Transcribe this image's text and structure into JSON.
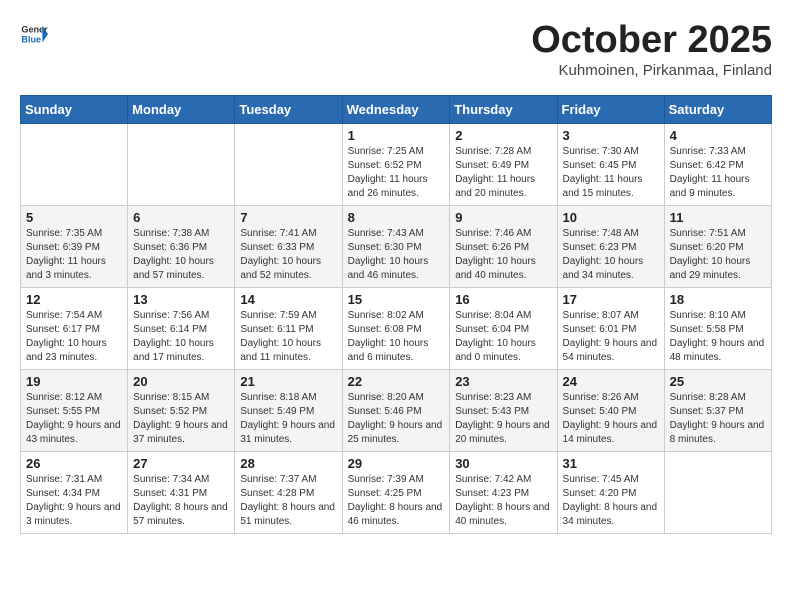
{
  "header": {
    "logo_general": "General",
    "logo_blue": "Blue",
    "month": "October 2025",
    "location": "Kuhmoinen, Pirkanmaa, Finland"
  },
  "days_of_week": [
    "Sunday",
    "Monday",
    "Tuesday",
    "Wednesday",
    "Thursday",
    "Friday",
    "Saturday"
  ],
  "weeks": [
    [
      {
        "day": "",
        "content": ""
      },
      {
        "day": "",
        "content": ""
      },
      {
        "day": "",
        "content": ""
      },
      {
        "day": "1",
        "content": "Sunrise: 7:25 AM\nSunset: 6:52 PM\nDaylight: 11 hours and 26 minutes."
      },
      {
        "day": "2",
        "content": "Sunrise: 7:28 AM\nSunset: 6:49 PM\nDaylight: 11 hours and 20 minutes."
      },
      {
        "day": "3",
        "content": "Sunrise: 7:30 AM\nSunset: 6:45 PM\nDaylight: 11 hours and 15 minutes."
      },
      {
        "day": "4",
        "content": "Sunrise: 7:33 AM\nSunset: 6:42 PM\nDaylight: 11 hours and 9 minutes."
      }
    ],
    [
      {
        "day": "5",
        "content": "Sunrise: 7:35 AM\nSunset: 6:39 PM\nDaylight: 11 hours and 3 minutes."
      },
      {
        "day": "6",
        "content": "Sunrise: 7:38 AM\nSunset: 6:36 PM\nDaylight: 10 hours and 57 minutes."
      },
      {
        "day": "7",
        "content": "Sunrise: 7:41 AM\nSunset: 6:33 PM\nDaylight: 10 hours and 52 minutes."
      },
      {
        "day": "8",
        "content": "Sunrise: 7:43 AM\nSunset: 6:30 PM\nDaylight: 10 hours and 46 minutes."
      },
      {
        "day": "9",
        "content": "Sunrise: 7:46 AM\nSunset: 6:26 PM\nDaylight: 10 hours and 40 minutes."
      },
      {
        "day": "10",
        "content": "Sunrise: 7:48 AM\nSunset: 6:23 PM\nDaylight: 10 hours and 34 minutes."
      },
      {
        "day": "11",
        "content": "Sunrise: 7:51 AM\nSunset: 6:20 PM\nDaylight: 10 hours and 29 minutes."
      }
    ],
    [
      {
        "day": "12",
        "content": "Sunrise: 7:54 AM\nSunset: 6:17 PM\nDaylight: 10 hours and 23 minutes."
      },
      {
        "day": "13",
        "content": "Sunrise: 7:56 AM\nSunset: 6:14 PM\nDaylight: 10 hours and 17 minutes."
      },
      {
        "day": "14",
        "content": "Sunrise: 7:59 AM\nSunset: 6:11 PM\nDaylight: 10 hours and 11 minutes."
      },
      {
        "day": "15",
        "content": "Sunrise: 8:02 AM\nSunset: 6:08 PM\nDaylight: 10 hours and 6 minutes."
      },
      {
        "day": "16",
        "content": "Sunrise: 8:04 AM\nSunset: 6:04 PM\nDaylight: 10 hours and 0 minutes."
      },
      {
        "day": "17",
        "content": "Sunrise: 8:07 AM\nSunset: 6:01 PM\nDaylight: 9 hours and 54 minutes."
      },
      {
        "day": "18",
        "content": "Sunrise: 8:10 AM\nSunset: 5:58 PM\nDaylight: 9 hours and 48 minutes."
      }
    ],
    [
      {
        "day": "19",
        "content": "Sunrise: 8:12 AM\nSunset: 5:55 PM\nDaylight: 9 hours and 43 minutes."
      },
      {
        "day": "20",
        "content": "Sunrise: 8:15 AM\nSunset: 5:52 PM\nDaylight: 9 hours and 37 minutes."
      },
      {
        "day": "21",
        "content": "Sunrise: 8:18 AM\nSunset: 5:49 PM\nDaylight: 9 hours and 31 minutes."
      },
      {
        "day": "22",
        "content": "Sunrise: 8:20 AM\nSunset: 5:46 PM\nDaylight: 9 hours and 25 minutes."
      },
      {
        "day": "23",
        "content": "Sunrise: 8:23 AM\nSunset: 5:43 PM\nDaylight: 9 hours and 20 minutes."
      },
      {
        "day": "24",
        "content": "Sunrise: 8:26 AM\nSunset: 5:40 PM\nDaylight: 9 hours and 14 minutes."
      },
      {
        "day": "25",
        "content": "Sunrise: 8:28 AM\nSunset: 5:37 PM\nDaylight: 9 hours and 8 minutes."
      }
    ],
    [
      {
        "day": "26",
        "content": "Sunrise: 7:31 AM\nSunset: 4:34 PM\nDaylight: 9 hours and 3 minutes."
      },
      {
        "day": "27",
        "content": "Sunrise: 7:34 AM\nSunset: 4:31 PM\nDaylight: 8 hours and 57 minutes."
      },
      {
        "day": "28",
        "content": "Sunrise: 7:37 AM\nSunset: 4:28 PM\nDaylight: 8 hours and 51 minutes."
      },
      {
        "day": "29",
        "content": "Sunrise: 7:39 AM\nSunset: 4:25 PM\nDaylight: 8 hours and 46 minutes."
      },
      {
        "day": "30",
        "content": "Sunrise: 7:42 AM\nSunset: 4:23 PM\nDaylight: 8 hours and 40 minutes."
      },
      {
        "day": "31",
        "content": "Sunrise: 7:45 AM\nSunset: 4:20 PM\nDaylight: 8 hours and 34 minutes."
      },
      {
        "day": "",
        "content": ""
      }
    ]
  ]
}
